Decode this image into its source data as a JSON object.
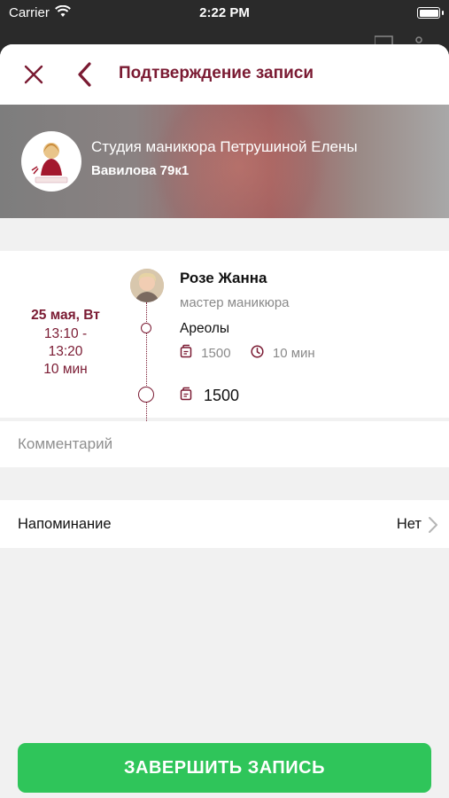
{
  "status_bar": {
    "carrier": "Carrier",
    "time": "2:22 PM"
  },
  "nav": {
    "title": "Подтверждение записи"
  },
  "salon": {
    "name": "Студия маникюра Петрушиной Елены",
    "address": "Вавилова 79к1"
  },
  "booking": {
    "date": "25 мая, Вт",
    "time_start": "13:10 -",
    "time_end": "13:20",
    "duration": "10 мин",
    "master_name": "Розе Жанна",
    "master_role": "мастер маникюра",
    "service_name": "Ареолы",
    "service_price": "1500",
    "service_duration": "10 мин",
    "total_price": "1500"
  },
  "comment": {
    "placeholder": "Комментарий"
  },
  "reminder": {
    "label": "Напоминание",
    "value": "Нет"
  },
  "submit": {
    "label": "ЗАВЕРШИТЬ ЗАПИСЬ"
  },
  "colors": {
    "accent": "#7a1a32",
    "button": "#2fc55a",
    "background": "#f1f1f1"
  }
}
